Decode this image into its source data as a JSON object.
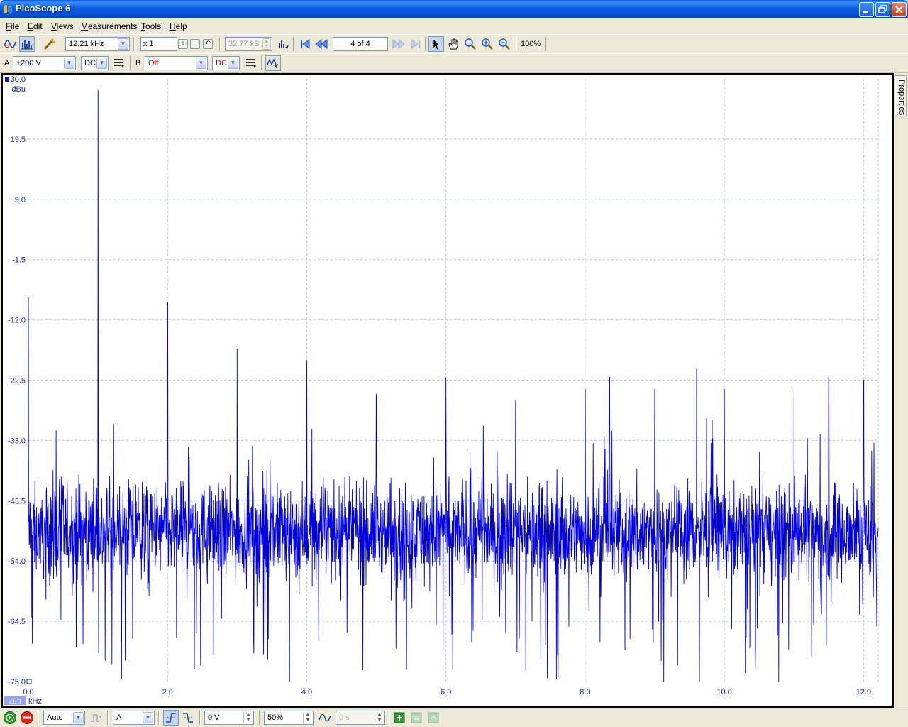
{
  "window": {
    "title": "PicoScope 6"
  },
  "menu": [
    {
      "label": "File",
      "underline": "F",
      "rest": "ile"
    },
    {
      "label": "Edit",
      "underline": "E",
      "rest": "dit"
    },
    {
      "label": "Views",
      "underline": "V",
      "rest": "iews"
    },
    {
      "label": "Measurements",
      "underline": "M",
      "rest": "easurements"
    },
    {
      "label": "Tools",
      "underline": "T",
      "rest": "ools"
    },
    {
      "label": "Help",
      "underline": "H",
      "rest": "elp"
    }
  ],
  "toolbar": {
    "spectrum_range": "12.21 kHz",
    "zoom_factor": "x 1",
    "samples": "32.77 kS",
    "buffer_position": "4 of 4",
    "zoom_level": "100%"
  },
  "channels": {
    "a": {
      "label": "A",
      "range": "±200 V",
      "coupling": "DC"
    },
    "b": {
      "label": "B",
      "range": "Off",
      "coupling": "DC"
    }
  },
  "sidebar": {
    "properties_tab": "Properties"
  },
  "trigger": {
    "mode": "Auto",
    "source": "A",
    "threshold": "0 V",
    "pre_trigger": "50%",
    "delay": "0 s"
  },
  "chart_data": {
    "type": "line",
    "title": "",
    "ylabel": "dBu",
    "xlabel": "kHz",
    "x_scale_label": "x1.0",
    "xlim": [
      0.0,
      12.21
    ],
    "ylim": [
      -75.0,
      30.0
    ],
    "y_ticks": [
      "30.0",
      "19.5",
      "9.0",
      "-1.5",
      "-12.0",
      "-22.5",
      "-33.0",
      "-43.5",
      "-54.0",
      "-64.5",
      "-75.0"
    ],
    "x_ticks": [
      "0.0",
      "2.0",
      "4.0",
      "6.0",
      "8.0",
      "10.0",
      "12.0"
    ],
    "grid": true,
    "noise_floor_dbu": -49.0,
    "noise_spread_dbu": 11.0,
    "series": [
      {
        "name": "A",
        "color": "#0000e0",
        "peaks": [
          {
            "x": 0.0,
            "y": -8.0
          },
          {
            "x": 1.0,
            "y": 28.0
          },
          {
            "x": 2.0,
            "y": -9.0
          },
          {
            "x": 3.0,
            "y": -17.0
          },
          {
            "x": 4.0,
            "y": -19.0
          },
          {
            "x": 5.0,
            "y": -25.0
          },
          {
            "x": 6.0,
            "y": -22.0
          },
          {
            "x": 7.0,
            "y": -26.0
          },
          {
            "x": 8.0,
            "y": -24.0
          },
          {
            "x": 8.35,
            "y": -22.0
          },
          {
            "x": 9.0,
            "y": -24.0
          },
          {
            "x": 9.6,
            "y": -20.5
          },
          {
            "x": 10.0,
            "y": -24.0
          },
          {
            "x": 11.0,
            "y": -24.0
          },
          {
            "x": 11.5,
            "y": -22.0
          },
          {
            "x": 12.0,
            "y": -22.5
          }
        ]
      }
    ]
  }
}
